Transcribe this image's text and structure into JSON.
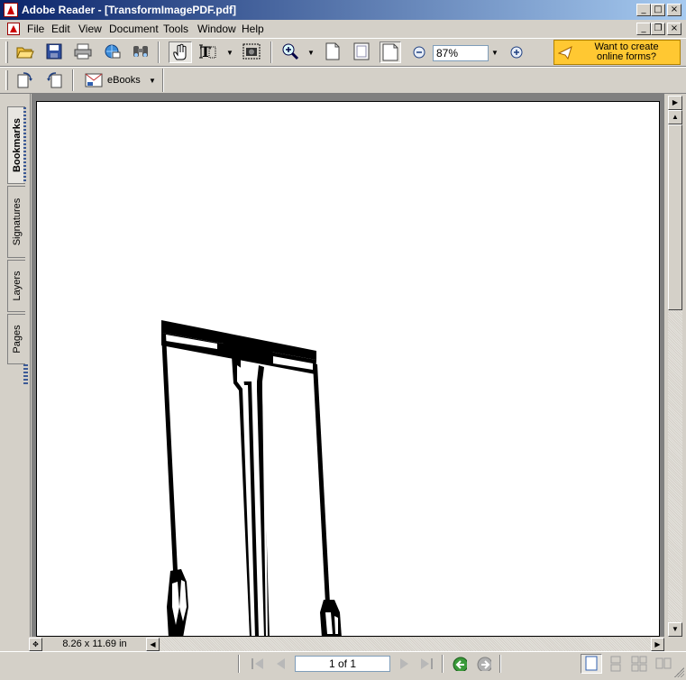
{
  "window": {
    "title": "Adobe Reader - [TransformImagePDF.pdf]"
  },
  "menu": {
    "items": [
      "File",
      "Edit",
      "View",
      "Document",
      "Tools",
      "Window",
      "Help"
    ]
  },
  "toolbar": {
    "zoom_value": "87%",
    "ebooks_label": "eBooks",
    "promo_line1": "Want to create",
    "promo_line2": "online forms?"
  },
  "side_tabs": [
    "Bookmarks",
    "Signatures",
    "Layers",
    "Pages"
  ],
  "document": {
    "page_size": "8.26 x 11.69 in"
  },
  "status": {
    "page_indicator": "1 of 1"
  },
  "colors": {
    "title_gradient_start": "#0a246a",
    "title_gradient_end": "#a6caf0",
    "promo_bg": "#ffc832",
    "face": "#d4d0c8"
  }
}
